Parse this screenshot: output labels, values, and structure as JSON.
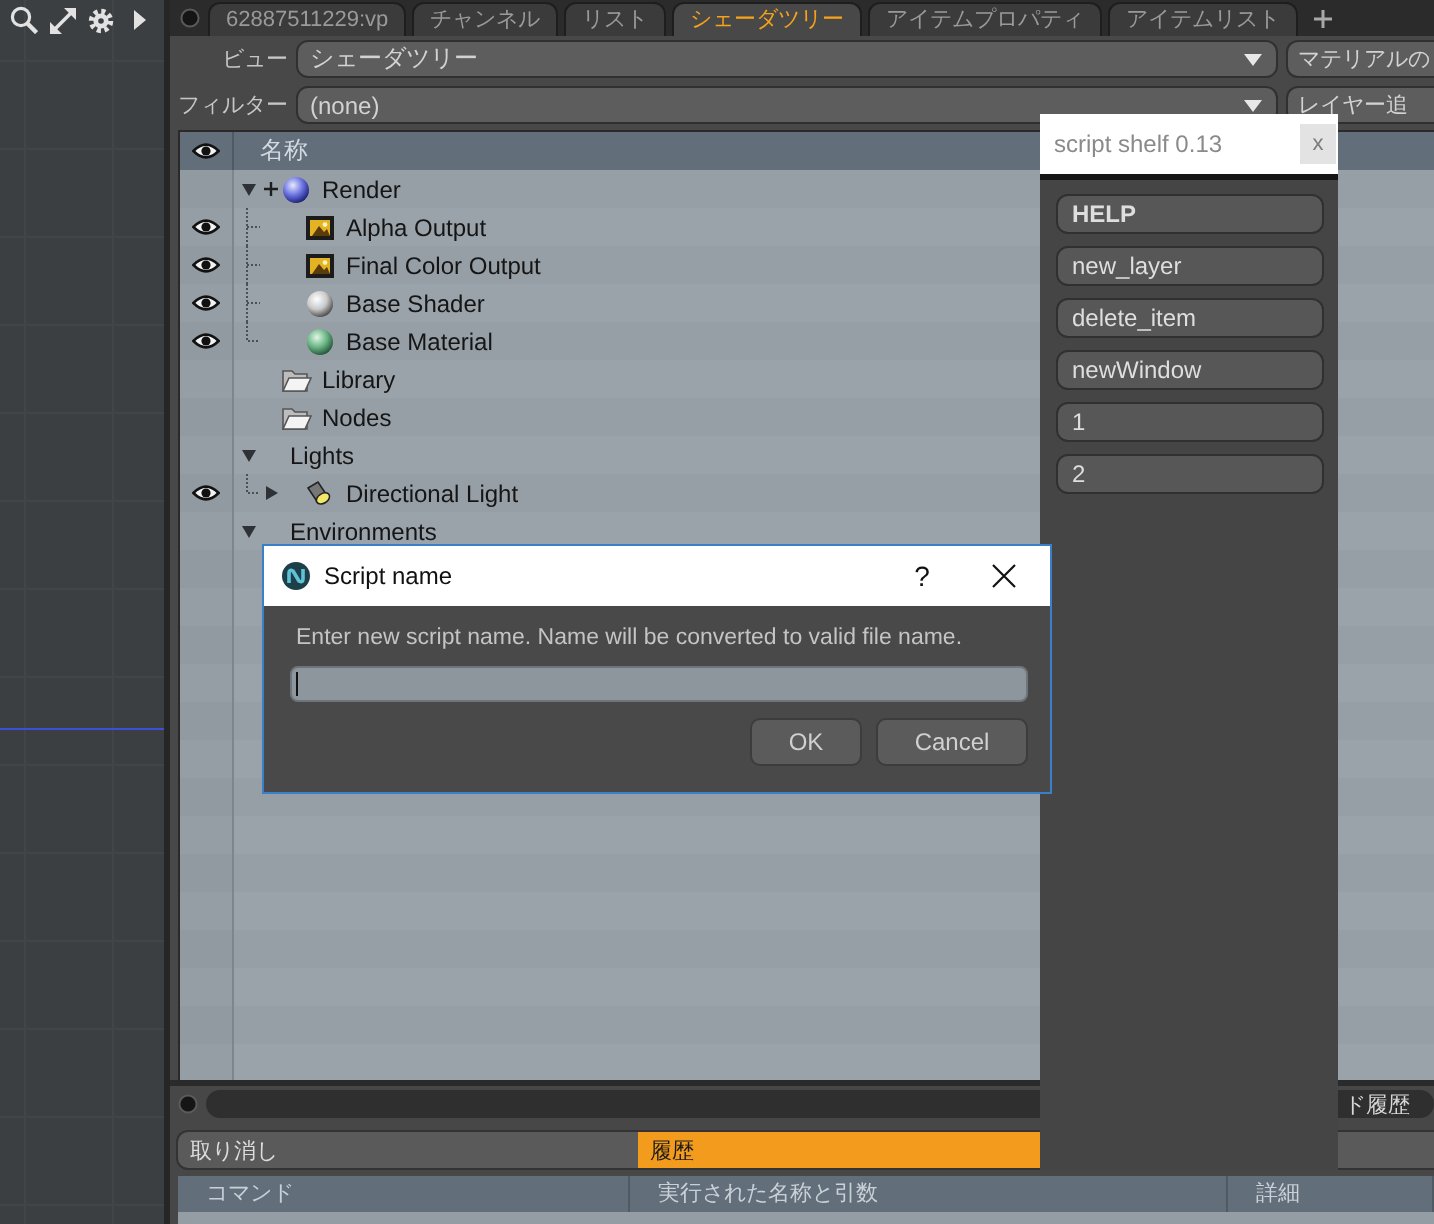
{
  "tabs": [
    {
      "label": "62887511229:vp",
      "selected": false
    },
    {
      "label": "チャンネル",
      "selected": false
    },
    {
      "label": "リスト",
      "selected": false
    },
    {
      "label": "シェーダツリー",
      "selected": true
    },
    {
      "label": "アイテムプロパティ",
      "selected": false
    },
    {
      "label": "アイテムリスト",
      "selected": false
    }
  ],
  "view_row": {
    "label": "ビュー",
    "value": "シェーダツリー",
    "button": "マテリアルの"
  },
  "filter_row": {
    "label": "フィルター",
    "value": "(none)",
    "button": "レイヤー追"
  },
  "tree": {
    "columns": [
      "名称"
    ],
    "items": [
      {
        "kind": "render",
        "label": "Render",
        "visible": false,
        "expanded": true,
        "children": [
          {
            "kind": "output",
            "label": "Alpha Output",
            "visible": true
          },
          {
            "kind": "output",
            "label": "Final Color Output",
            "visible": true
          },
          {
            "kind": "shader",
            "label": "Base Shader",
            "visible": true
          },
          {
            "kind": "material",
            "label": "Base Material",
            "visible": true
          }
        ]
      },
      {
        "kind": "folder",
        "label": "Library",
        "visible": false
      },
      {
        "kind": "folder",
        "label": "Nodes",
        "visible": false
      },
      {
        "kind": "group",
        "label": "Lights",
        "visible": false,
        "expanded": true,
        "children": [
          {
            "kind": "light",
            "label": "Directional Light",
            "visible": true,
            "expanded": false
          }
        ]
      },
      {
        "kind": "group",
        "label": "Environments",
        "visible": false,
        "expanded": true
      }
    ]
  },
  "history": {
    "title": "ド履歴",
    "tabs": [
      {
        "label": "取り消し",
        "selected": false
      },
      {
        "label": "履歴",
        "selected": true
      }
    ],
    "table": {
      "columns": [
        "コマンド",
        "実行された名称と引数",
        "詳細"
      ]
    }
  },
  "script_shelf": {
    "title": "script shelf 0.13",
    "close": "x",
    "buttons": [
      {
        "kind": "help",
        "label": "HELP"
      },
      {
        "kind": "script",
        "label": "new_layer"
      },
      {
        "kind": "script",
        "label": "delete_item"
      },
      {
        "kind": "script",
        "label": "newWindow"
      },
      {
        "kind": "script",
        "label": "1"
      },
      {
        "kind": "script",
        "label": "2"
      }
    ]
  },
  "dialog": {
    "title": "Script name",
    "help": "?",
    "message": "Enter new script name. Name will be converted to valid file name.",
    "buttons": [
      "OK",
      "Cancel"
    ]
  }
}
